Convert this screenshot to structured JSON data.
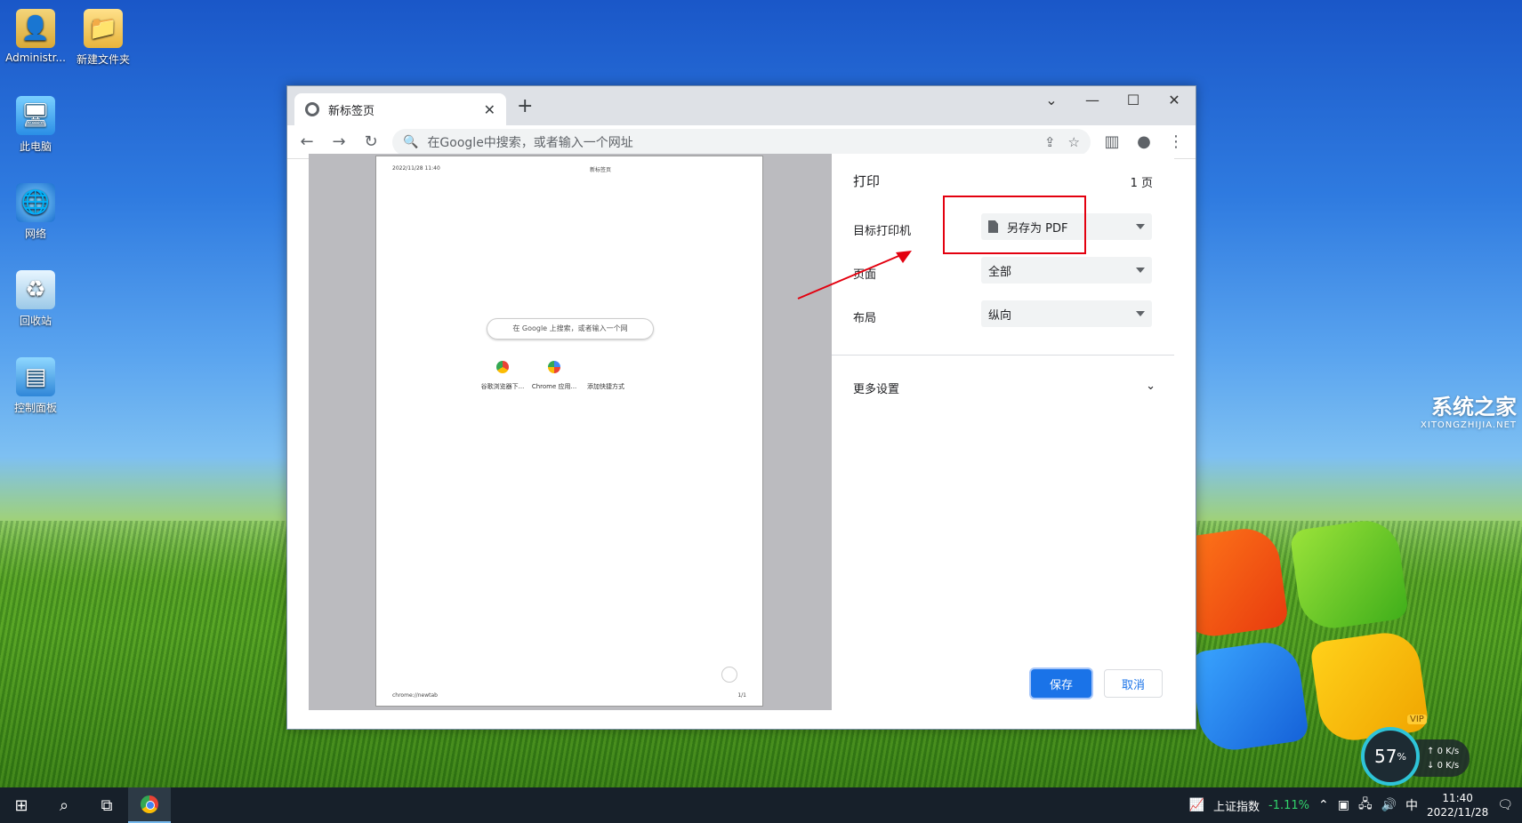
{
  "desktop": {
    "icons": [
      {
        "label": "Administr..."
      },
      {
        "label": "新建文件夹"
      },
      {
        "label": "此电脑"
      },
      {
        "label": "网络"
      },
      {
        "label": "回收站"
      },
      {
        "label": "控制面板"
      }
    ],
    "watermark": {
      "big": "系统之家",
      "small": "XITONGZHIJIA.NET"
    }
  },
  "browser": {
    "tab_title": "新标签页",
    "omnibox_placeholder": "在Google中搜索，或者输入一个网址"
  },
  "print": {
    "title": "打印",
    "page_count": "1 页",
    "destination_label": "目标打印机",
    "destination_value": "另存为 PDF",
    "pages_label": "页面",
    "pages_value": "全部",
    "layout_label": "布局",
    "layout_value": "纵向",
    "more_settings": "更多设置",
    "save_label": "保存",
    "cancel_label": "取消",
    "preview": {
      "header_date": "2022/11/28 11:40",
      "header_title": "新标签页",
      "search_text": "在 Google 上搜索，或者输入一个网",
      "shortcuts": [
        "谷歌浏览器下...",
        "Chrome 应用...",
        "添加快捷方式"
      ],
      "footer_url": "chrome://newtab",
      "footer_page": "1/1"
    }
  },
  "netwidget": {
    "percent": "57",
    "unit": "%",
    "up": "0 K/s",
    "down": "0 K/s",
    "badge": "VIP"
  },
  "taskbar": {
    "stock_name": "上证指数",
    "stock_change": "-1.11%",
    "ime": "中",
    "time": "11:40",
    "date": "2022/11/28"
  },
  "colors": {
    "accent": "#1a73e8",
    "highlight": "#e3000f"
  }
}
